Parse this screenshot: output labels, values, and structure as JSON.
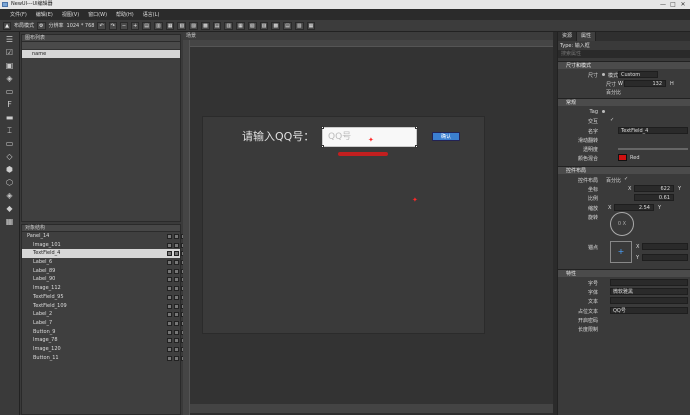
{
  "window": {
    "title": "NewUI---UI编辑器",
    "min": "—",
    "max": "□",
    "close": "✕"
  },
  "menu": [
    "文件(F)",
    "编辑(E)",
    "视图(V)",
    "窗口(W)",
    "帮助(H)",
    "语言(L)"
  ],
  "toolbar": {
    "mode_label": "布局模式",
    "resolution_label": "分辨率",
    "resolution_value": "1024 * 768"
  },
  "left": {
    "list_title": "图布列表",
    "list_item": "name",
    "tree_title": "对象结构"
  },
  "tree": [
    "Panel_14",
    "Image_101",
    "TextField_4",
    "Label_6",
    "Label_89",
    "Label_90",
    "Image_112",
    "TextField_95",
    "TextField_109",
    "Label_2",
    "Label_7",
    "Button_9",
    "Image_78",
    "Image_120",
    "Button_11"
  ],
  "scene": {
    "title": "场景",
    "stage_label": "请输入QQ号：",
    "field_placeholder": "QQ号",
    "button_label": "确认"
  },
  "inspector": {
    "tab1": "资源",
    "tab2": "属性",
    "type_label": "Type: 输入框",
    "search_placeholder": "搜索属性",
    "sec_size": "尺寸和模式",
    "size_label": "尺寸",
    "mode_label": "模式",
    "mode_value": "Custom",
    "size_sub": "尺寸",
    "w_label": "W",
    "w_value": "132",
    "h_label": "H",
    "percent_label": "百分比",
    "sec_common": "常规",
    "tag_label": "Tag",
    "interact_label": "交互",
    "check": "✓",
    "name_label": "名字",
    "name_value": "TextField_4",
    "flip_label": "滑动翻转",
    "opacity_label": "透明度",
    "color_label": "颜色混合",
    "color_value": "Red",
    "color_swatch": "#d01010",
    "sec_layout": "控件布局",
    "pos_label": "坐标",
    "pos_x_label": "X",
    "pos_x": "622",
    "pos_y_label": "Y",
    "pos_percent_label": "百分比",
    "ratio_label": "比例",
    "ratio_x": "0.61",
    "scale_label": "缩放",
    "scale_x_label": "X",
    "scale_x": "2.54",
    "scale_y_label": "Y",
    "rotate_label": "旋转",
    "rotate_center": "0 X",
    "anchor_label": "锚点",
    "anchor_x_label": "X",
    "anchor_y_label": "Y",
    "layout_sub_label": "控件布局",
    "pct_label": "百分比",
    "sec_features": "特性",
    "fontsize_label": "字号",
    "font_label": "字体",
    "font_value": "微软雅黑",
    "text_label": "文本",
    "placeholder_label": "占位文本",
    "placeholder_value": "QQ号",
    "password_label": "开启密码",
    "maxlen_label": "长度限制"
  }
}
